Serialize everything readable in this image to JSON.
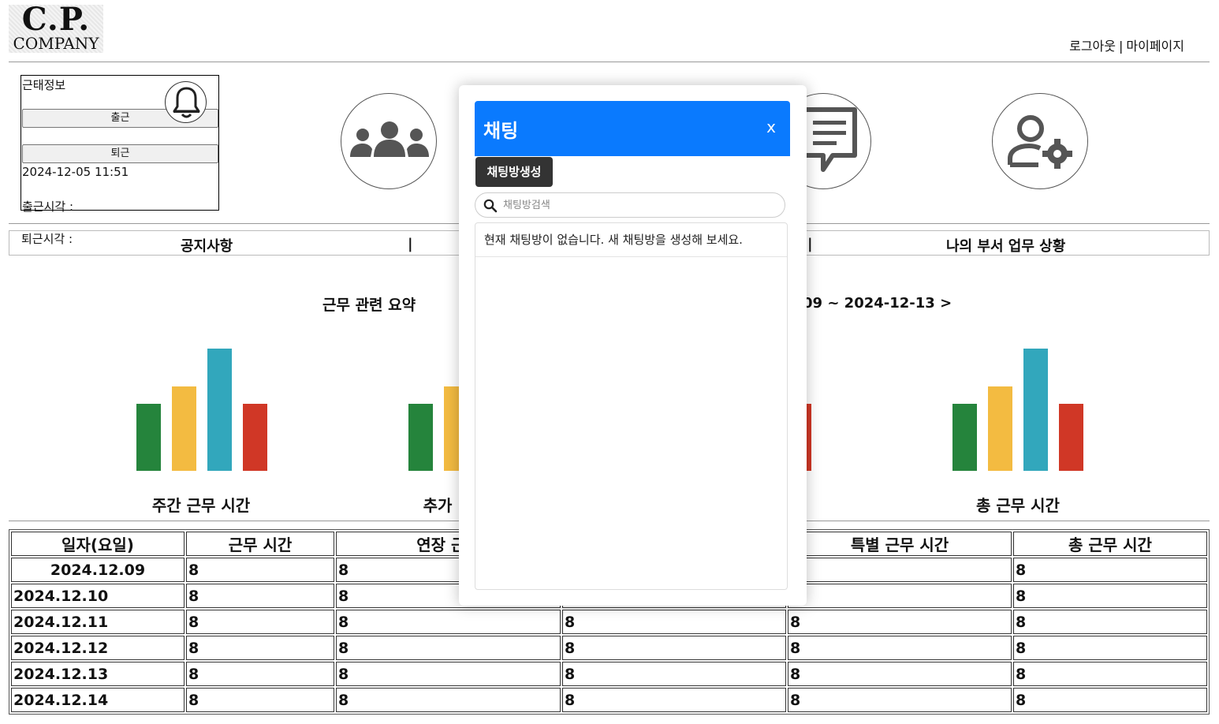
{
  "header": {
    "logo_line1": "C.P.",
    "logo_line2": "COMPANY",
    "logout_label": "로그아웃",
    "separator": "|",
    "mypage_label": "마이페이지"
  },
  "attendance": {
    "title": "근태정보",
    "clock_in_button": "출근",
    "clock_out_button": "퇴근",
    "current_datetime": "2024-12-05 11:51",
    "clock_in_time_label": "출근시각 :",
    "clock_out_time_label": "퇴근시각 :"
  },
  "nav": {
    "items": [
      "공지사항",
      "나의 부서 업무 상황"
    ],
    "separator": "|"
  },
  "summary": {
    "title": "근무 관련 요약",
    "period_text": "09 ~ 2024-12-13 >",
    "chart_labels": [
      "주간 근무 시간",
      "추가",
      "총 근무 시간"
    ],
    "bar_colors": [
      "#25843c",
      "#f3bb41",
      "#32a7bc",
      "#d03726"
    ],
    "bar_levels": [
      0.55,
      0.69,
      1.0,
      0.55
    ]
  },
  "table": {
    "headers": [
      "일자(요일)",
      "근무 시간",
      "연장 근무",
      "",
      "특별 근무 시간",
      "총 근무 시간"
    ],
    "rows": [
      [
        "2024.12.09",
        "8",
        "8",
        "",
        "",
        "8"
      ],
      [
        "2024.12.10",
        "8",
        "8",
        "",
        "",
        "8"
      ],
      [
        "2024.12.11",
        "8",
        "8",
        "8",
        "8",
        "8"
      ],
      [
        "2024.12.12",
        "8",
        "8",
        "8",
        "8",
        "8"
      ],
      [
        "2024.12.13",
        "8",
        "8",
        "8",
        "8",
        "8"
      ],
      [
        "2024.12.14",
        "8",
        "8",
        "8",
        "8",
        "8"
      ]
    ]
  },
  "chat": {
    "title": "채팅",
    "close_label": "x",
    "create_button": "채팅방생성",
    "search_placeholder": "채팅방검색",
    "empty_message": "현재 채팅방이 없습니다. 새 채팅방을 생성해 보세요.",
    "header_color": "#0a7afe"
  },
  "icons": [
    "bell-icon",
    "users-icon",
    "chat-icon",
    "user-settings-icon",
    "search-icon"
  ]
}
